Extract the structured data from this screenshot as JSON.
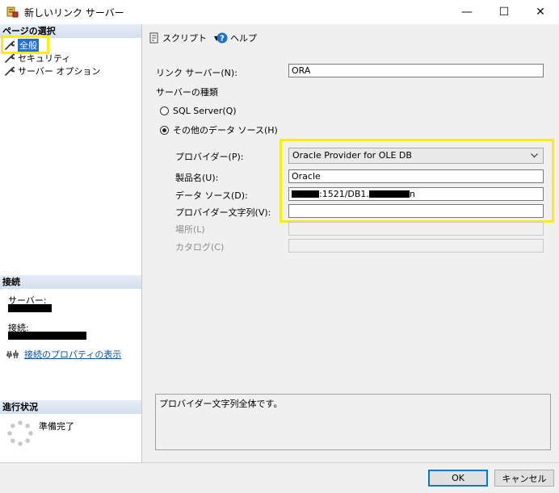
{
  "window": {
    "title": "新しいリンク サーバー",
    "minimize_glyph": "—",
    "maximize_glyph": "☐",
    "close_glyph": "✕"
  },
  "left_panel": {
    "page_select_header": "ページの選択",
    "pages": [
      {
        "label": "全般",
        "icon": "wrench-icon",
        "selected": true
      },
      {
        "label": "セキュリティ",
        "icon": "wrench-icon",
        "selected": false
      },
      {
        "label": "サーバー オプション",
        "icon": "wrench-icon",
        "selected": false
      }
    ],
    "connection_header": "接続",
    "server_label": "サーバー:",
    "connection_label": "接続:",
    "connection_properties_link": "接続のプロパティの表示",
    "progress_header": "進行状況",
    "progress_status": "準備完了"
  },
  "toolbar": {
    "script_label": "スクリプト",
    "help_label": "ヘルプ"
  },
  "form": {
    "linked_server_label": "リンク サーバー(N):",
    "linked_server_value": "ORA",
    "server_type_label": "サーバーの種類",
    "sql_server_option": "SQL Server(Q)",
    "other_source_option": "その他のデータ ソース(H)",
    "selected_server_type": "other",
    "provider_label": "プロバイダー(P):",
    "provider_value": "Oracle Provider for OLE DB",
    "product_name_label": "製品名(U):",
    "product_name_value": "Oracle",
    "data_source_label": "データ ソース(D):",
    "data_source_visible": ":1521/DB1.",
    "data_source_tail": "n",
    "provider_string_label": "プロバイダー文字列(V):",
    "provider_string_value": "",
    "location_label": "場所(L)",
    "location_value": "",
    "catalog_label": "カタログ(C)",
    "catalog_value": "",
    "description": "プロバイダー文字列全体です。"
  },
  "footer": {
    "ok_label": "OK",
    "cancel_label": "キャンセル"
  },
  "colors": {
    "highlight_box": "#ffee00",
    "selection": "#1e6fd9",
    "link": "#0b4ea2",
    "default_button_border": "#0078d7"
  }
}
